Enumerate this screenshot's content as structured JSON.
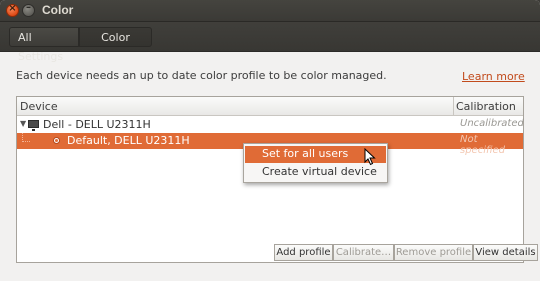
{
  "window": {
    "title": "Color"
  },
  "toolbar": {
    "all_settings": "All Settings",
    "current": "Color"
  },
  "info": {
    "text": "Each device needs an up to date color profile to be color managed.",
    "learn_more": "Learn more"
  },
  "table": {
    "columns": [
      "Device",
      "Calibration"
    ],
    "device": {
      "name": "Dell - DELL U2311H",
      "calibration": "Uncalibrated"
    },
    "profile": {
      "name": "Default, DELL U2311H",
      "calibration": "Not specified"
    }
  },
  "buttons": {
    "add_profile": "Add profile",
    "calibrate": "Calibrate…",
    "remove_profile": "Remove profile",
    "view_details": "View details"
  },
  "context_menu": {
    "items": [
      "Set for all users",
      "Create virtual device"
    ]
  },
  "colors": {
    "accent": "#e06b36",
    "link": "#c24b1c",
    "titlebar": "#3c3b37"
  }
}
